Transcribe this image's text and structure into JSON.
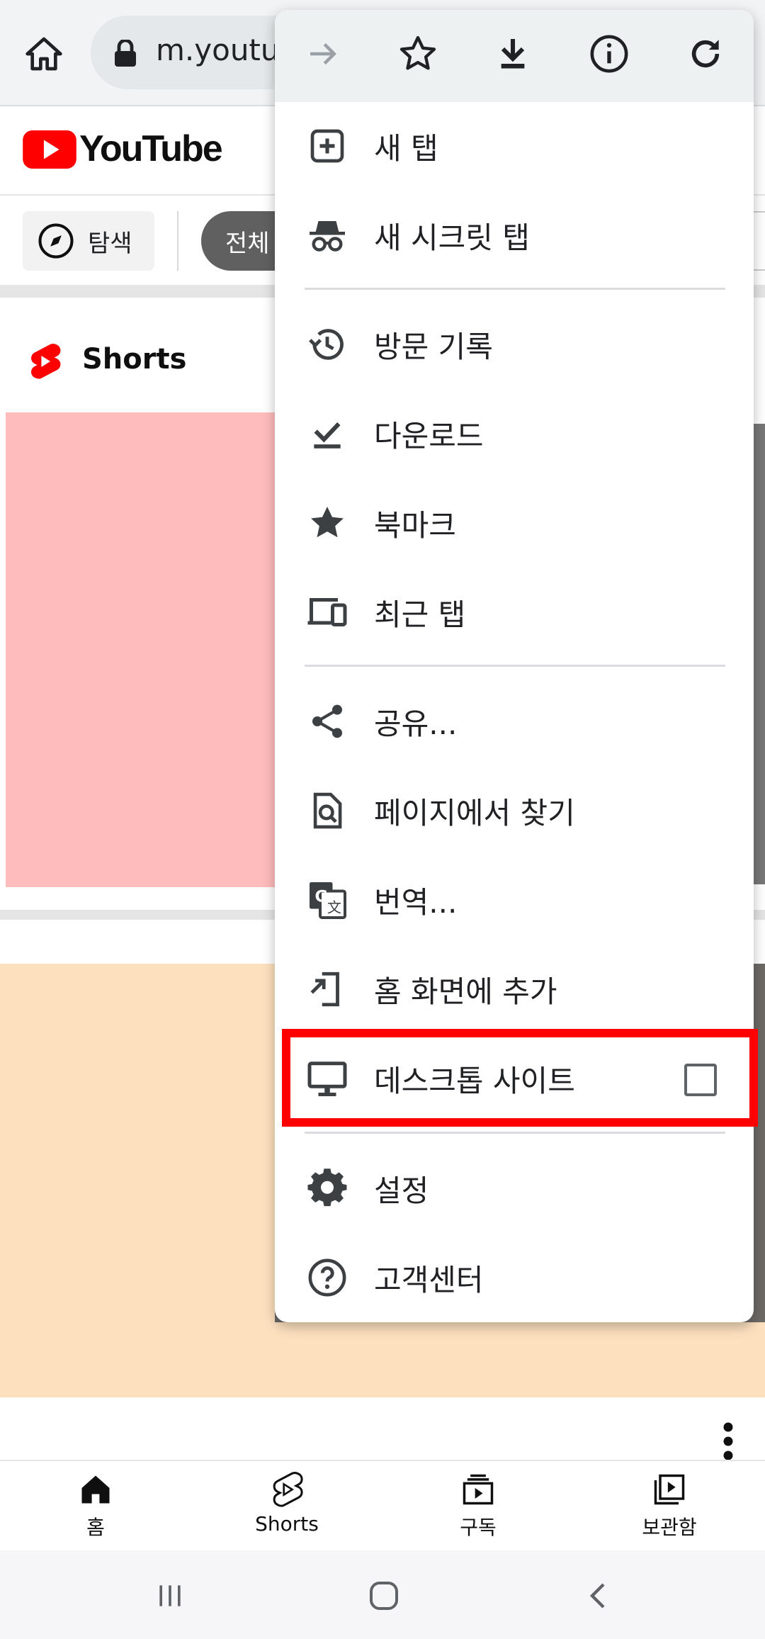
{
  "browser": {
    "url": "m.youtu"
  },
  "youtube": {
    "logo_text": "YouTube",
    "explore_label": "탐색",
    "all_chip": "전체",
    "shorts_title": "Shorts"
  },
  "bottom_nav": [
    {
      "label": "홈",
      "icon": "home-icon"
    },
    {
      "label": "Shorts",
      "icon": "shorts-icon"
    },
    {
      "label": "구독",
      "icon": "subscriptions-icon"
    },
    {
      "label": "보관함",
      "icon": "library-icon"
    }
  ],
  "menu": {
    "top_icons": [
      "forward-icon",
      "bookmark-star-icon",
      "download-icon",
      "info-icon",
      "refresh-icon"
    ],
    "items": [
      {
        "label": "새 탭",
        "icon": "new-tab-icon"
      },
      {
        "label": "새 시크릿 탭",
        "icon": "incognito-icon"
      },
      {
        "label": "방문 기록",
        "icon": "history-icon"
      },
      {
        "label": "다운로드",
        "icon": "downloads-icon"
      },
      {
        "label": "북마크",
        "icon": "bookmarks-icon"
      },
      {
        "label": "최근 탭",
        "icon": "recent-tabs-icon"
      },
      {
        "label": "공유...",
        "icon": "share-icon"
      },
      {
        "label": "페이지에서 찾기",
        "icon": "find-in-page-icon"
      },
      {
        "label": "번역...",
        "icon": "translate-icon"
      },
      {
        "label": "홈 화면에 추가",
        "icon": "add-to-home-icon"
      },
      {
        "label": "데스크톱 사이트",
        "icon": "desktop-icon",
        "checked": false
      },
      {
        "label": "설정",
        "icon": "settings-icon"
      },
      {
        "label": "고객센터",
        "icon": "help-icon"
      }
    ]
  },
  "colors": {
    "highlight": "#ff0000",
    "youtube_red": "#ff0000",
    "menu_bar": "#eef1f2"
  }
}
